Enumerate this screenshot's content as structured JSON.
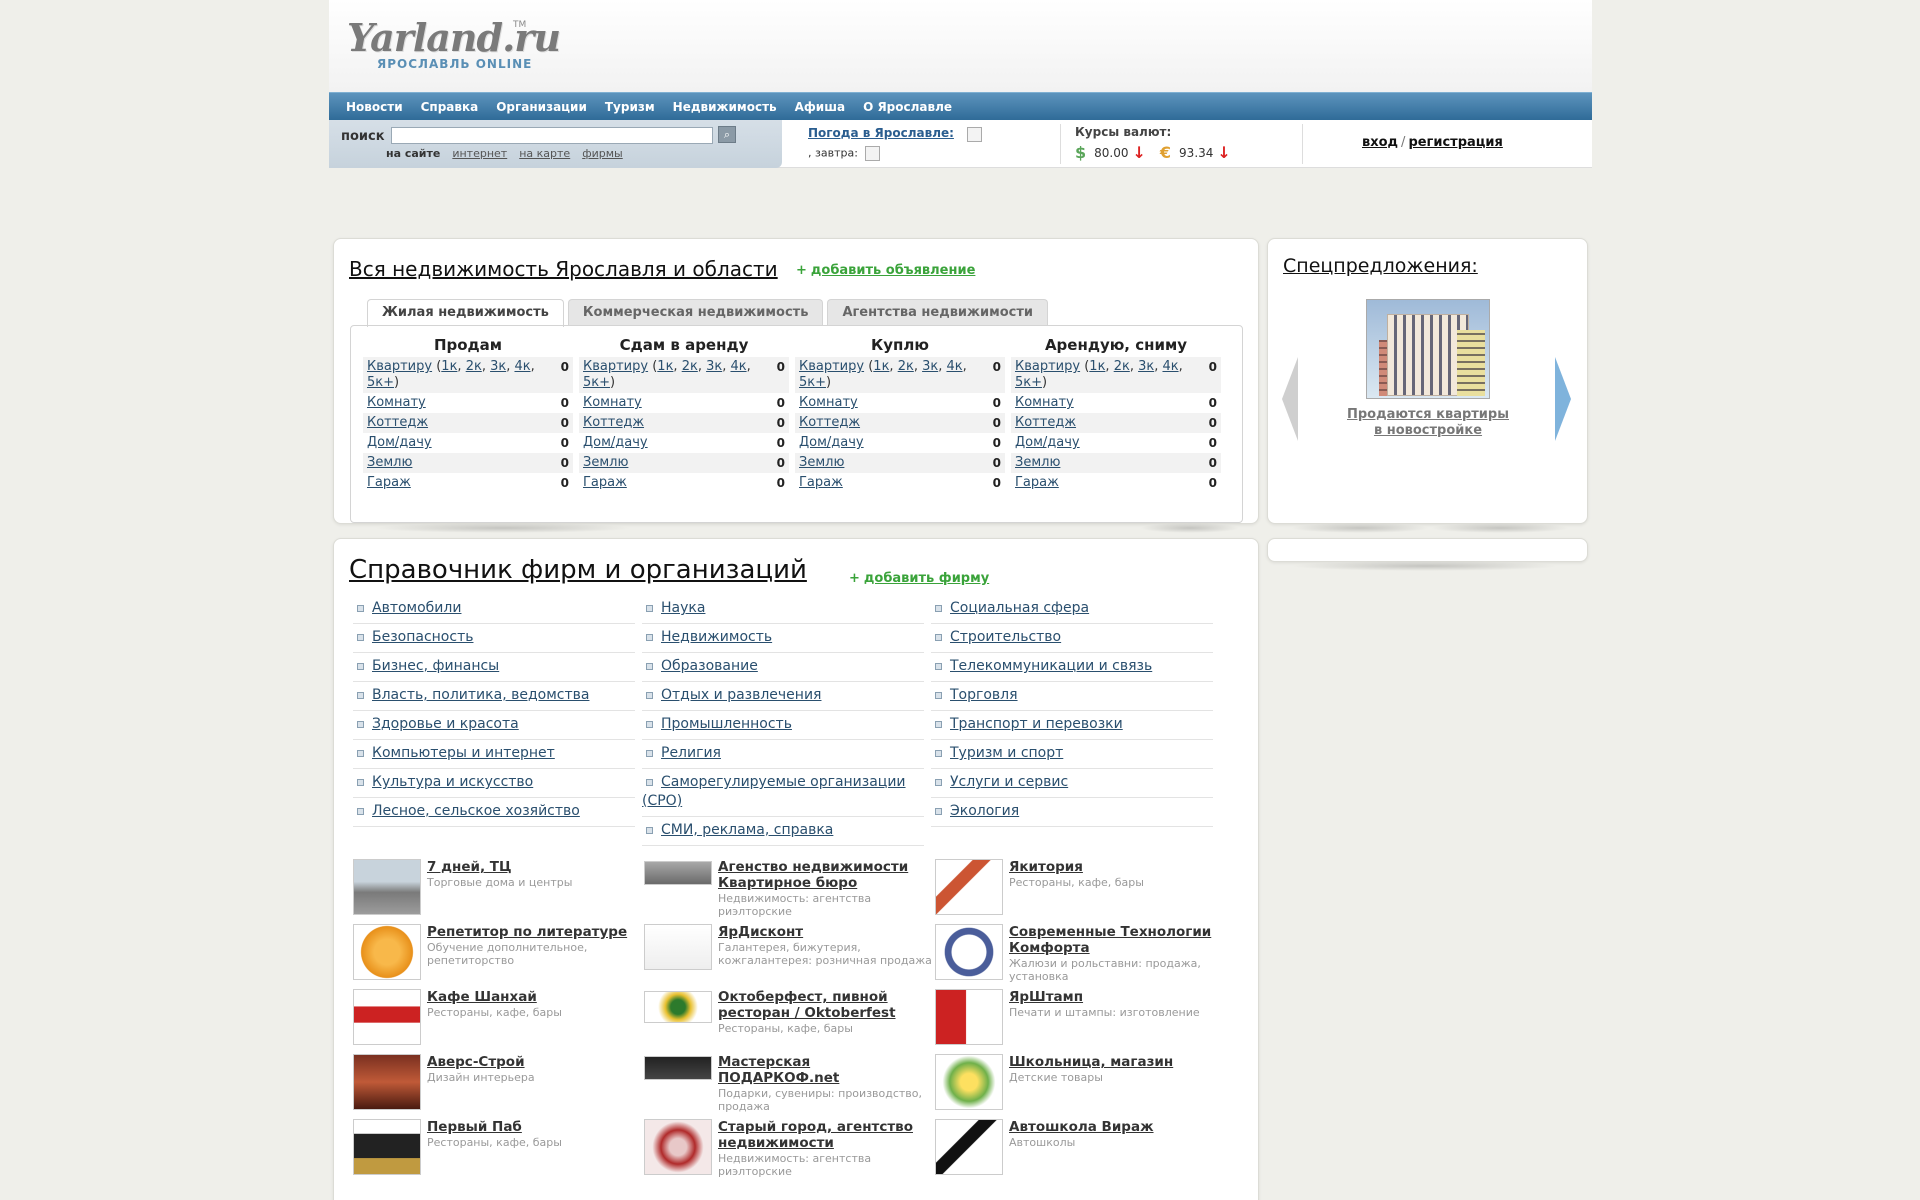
{
  "logo": {
    "main": "Yarland.ru",
    "tm": "TM",
    "sub": "ЯРОСЛАВЛЬ ONLINE"
  },
  "nav": [
    "Новости",
    "Справка",
    "Организации",
    "Туризм",
    "Недвижимость",
    "Афиша",
    "О Ярославле"
  ],
  "search": {
    "label": "поиск",
    "placeholder": "",
    "button_icon": "search-button-icon",
    "current": "на сайте",
    "options": [
      "интернет",
      "на карте",
      "фирмы"
    ]
  },
  "weather": {
    "title": "Погода в Ярославле:",
    "tomorrow": ", завтра:"
  },
  "rates": {
    "title": "Курсы валют:",
    "usd_symbol": "$",
    "usd": "80.00",
    "eur_symbol": "€",
    "eur": "93.34",
    "down": "↓"
  },
  "auth": {
    "login": "вход",
    "sep": "/",
    "register": "регистрация"
  },
  "realty": {
    "title": "Вся недвижимость Ярославля и области",
    "add_plus": "+",
    "add": "добавить объявление",
    "tabs": [
      "Жилая недвижимость",
      "Коммерческая недвижимость",
      "Агентства недвижимости"
    ],
    "columns": [
      {
        "head": "Продам",
        "rows": [
          {
            "label": "Квартиру",
            "count": "0"
          },
          {
            "label": "Комнату",
            "count": "0"
          },
          {
            "label": "Коттедж",
            "count": "0"
          },
          {
            "label": "Дом/дачу",
            "count": "0"
          },
          {
            "label": "Землю",
            "count": "0"
          },
          {
            "label": "Гараж",
            "count": "0"
          }
        ]
      },
      {
        "head": "Сдам в аренду",
        "rows": [
          {
            "label": "Квартиру",
            "count": "0"
          },
          {
            "label": "Комнату",
            "count": "0"
          },
          {
            "label": "Коттедж",
            "count": "0"
          },
          {
            "label": "Дом/дачу",
            "count": "0"
          },
          {
            "label": "Землю",
            "count": "0"
          },
          {
            "label": "Гараж",
            "count": "0"
          }
        ]
      },
      {
        "head": "Куплю",
        "rows": [
          {
            "label": "Квартиру",
            "count": "0"
          },
          {
            "label": "Комнату",
            "count": "0"
          },
          {
            "label": "Коттедж",
            "count": "0"
          },
          {
            "label": "Дом/дачу",
            "count": "0"
          },
          {
            "label": "Землю",
            "count": "0"
          },
          {
            "label": "Гараж",
            "count": "0"
          }
        ]
      },
      {
        "head": "Арендую, сниму",
        "rows": [
          {
            "label": "Квартиру",
            "count": "0"
          },
          {
            "label": "Комнату",
            "count": "0"
          },
          {
            "label": "Коттедж",
            "count": "0"
          },
          {
            "label": "Дом/дачу",
            "count": "0"
          },
          {
            "label": "Землю",
            "count": "0"
          },
          {
            "label": "Гараж",
            "count": "0"
          }
        ]
      }
    ],
    "rooms": [
      "1к",
      "2к",
      "3к",
      "4к",
      "5к+"
    ]
  },
  "special": {
    "title": "Спецпредложения:",
    "caption_line1": "Продаются квартиры",
    "caption_line2": "в новостройке"
  },
  "directory": {
    "title": "Справочник фирм и организаций",
    "add_plus": "+",
    "add": "добавить фирму",
    "col1": [
      "Автомобили",
      "Безопасность",
      "Бизнес, финансы",
      "Власть, политика, ведомства",
      "Здоровье и красота",
      "Компьютеры и интернет",
      "Культура и искусство",
      "Лесное, сельское хозяйство"
    ],
    "col2": [
      "Наука",
      "Недвижимость",
      "Образование",
      "Отдых и развлечения",
      "Промышленность",
      "Религия",
      "Саморегулируемые организации (СРО)",
      "СМИ, реклама, справка"
    ],
    "col3": [
      "Социальная сфера",
      "Строительство",
      "Телекоммуникации и связь",
      "Торговля",
      "Транспорт и перевозки",
      "Туризм и спорт",
      "Услуги и сервис",
      "Экология"
    ]
  },
  "firms": [
    [
      {
        "name": "7 дней, ТЦ",
        "cat": "Торговые дома и центры"
      },
      {
        "name": "Агенство недвижимости Квартирное бюро",
        "cat": "Недвижимость: агентства риэлторские"
      },
      {
        "name": "Якитория",
        "cat": "Рестораны, кафе, бары"
      }
    ],
    [
      {
        "name": "Репетитор по литературе",
        "cat": "Обучение дополнительное, репетиторство"
      },
      {
        "name": "ЯрДисконт",
        "cat": "Галантерея, бижутерия, кожгалантерея: розничная продажа"
      },
      {
        "name": "Современные Технологии Комфорта",
        "cat": "Жалюзи и рольставни: продажа, установка"
      }
    ],
    [
      {
        "name": "Кафе Шанхай",
        "cat": "Рестораны, кафе, бары"
      },
      {
        "name": "Октоберфест, пивной ресторан / Oktoberfest",
        "cat": "Рестораны, кафе, бары"
      },
      {
        "name": "ЯрШтамп",
        "cat": "Печати и штампы: изготовление"
      }
    ],
    [
      {
        "name": "Аверс-Строй",
        "cat": "Дизайн интерьера"
      },
      {
        "name": "Мастерская ПОДАРКОФ.net",
        "cat": "Подарки, сувениры: производство, продажа"
      },
      {
        "name": "Школьница, магазин",
        "cat": "Детские товары"
      }
    ],
    [
      {
        "name": "Первый Паб",
        "cat": "Рестораны, кафе, бары"
      },
      {
        "name": "Старый город, агентство недвижимости",
        "cat": "Недвижимость: агентства риэлторские"
      },
      {
        "name": "Автошкола Вираж",
        "cat": "Автошколы"
      }
    ]
  ],
  "colors": {
    "nav": "#2f6b98",
    "accent_green": "#3aa33a",
    "link": "#2a4f6e",
    "panel_bg": "#ffffff",
    "page_bg": "#efefea"
  }
}
